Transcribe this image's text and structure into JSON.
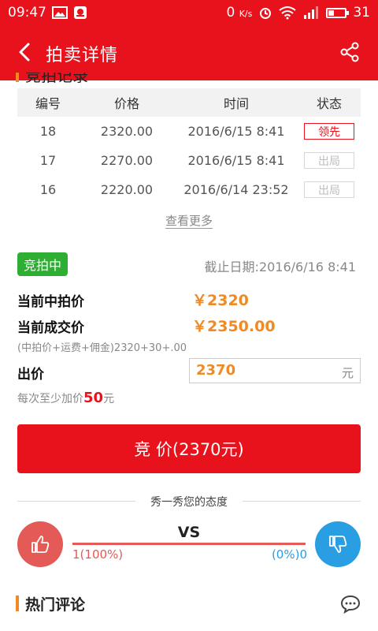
{
  "status_bar": {
    "time": "09:47",
    "network_speed": "0",
    "network_unit": "K/s",
    "battery": "31",
    "battery_fraction": 0.31
  },
  "app_bar": {
    "title": "拍卖详情",
    "back_icon": "chevron-left-icon",
    "share_icon": "share-icon"
  },
  "section_peek": {
    "label": "竞拍记录"
  },
  "bid_table": {
    "headers": [
      "编号",
      "价格",
      "时间",
      "状态"
    ],
    "rows": [
      {
        "no": "18",
        "price": "2320.00",
        "time": "2016/6/15 8:41",
        "status": "领先",
        "status_type": "lead"
      },
      {
        "no": "17",
        "price": "2270.00",
        "time": "2016/6/15 8:41",
        "status": "出局",
        "status_type": "out"
      },
      {
        "no": "16",
        "price": "2220.00",
        "time": "2016/6/14 23:52",
        "status": "出局",
        "status_type": "out"
      }
    ],
    "more_link": "查看更多"
  },
  "auction": {
    "status_badge": "竞拍中",
    "deadline": "截止日期:2016/6/16 8:41",
    "current_bid_label": "当前中拍价",
    "current_bid_value": "￥2320",
    "deal_price_label": "当前成交价",
    "deal_price_value": "￥2350.00",
    "formula": "(中拍价+运费+佣金)2320+30+.00",
    "offer_label": "出价",
    "offer_value": "2370",
    "offer_unit": "元",
    "min_increment_prefix": "每次至少加价",
    "min_increment_value": "50",
    "min_increment_suffix": "元",
    "bid_button": "竞 价(2370元)"
  },
  "attitude": {
    "title": "秀一秀您的态度",
    "vs": "VS",
    "like_count": "1(100%)",
    "dislike_count": "(0%)0",
    "like_fraction": 1.0,
    "like_icon": "thumbs-up-icon",
    "dislike_icon": "thumbs-down-icon",
    "like_color": "#e45a56",
    "dislike_color": "#2a9ee3"
  },
  "hot_comments": {
    "title": "热门评论",
    "icon": "comment-icon"
  },
  "colors": {
    "brand_red": "#e8121c",
    "accent_orange": "#f08a24",
    "active_green": "#2eae33"
  }
}
